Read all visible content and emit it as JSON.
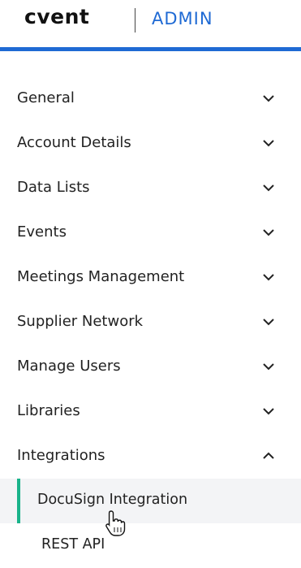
{
  "header": {
    "logo_text": "cvent",
    "section_title": "ADMIN"
  },
  "colors": {
    "brand_blue": "#1f6ad4",
    "active_accent": "#19b38a",
    "active_bg": "#f3f4f6"
  },
  "nav": {
    "items": [
      {
        "label": "General",
        "icon": "chevron-down-icon"
      },
      {
        "label": "Account Details",
        "icon": "chevron-down-icon"
      },
      {
        "label": "Data Lists",
        "icon": "chevron-down-icon"
      },
      {
        "label": "Events",
        "icon": "chevron-down-icon"
      },
      {
        "label": "Meetings Management",
        "icon": "chevron-down-icon"
      },
      {
        "label": "Supplier Network",
        "icon": "chevron-down-icon"
      },
      {
        "label": "Manage Users",
        "icon": "chevron-down-icon"
      },
      {
        "label": "Libraries",
        "icon": "chevron-down-icon"
      },
      {
        "label": "Integrations",
        "icon": "chevron-up-icon",
        "expanded": true
      }
    ],
    "integrations_children": [
      {
        "label": "DocuSign Integration",
        "active": true
      },
      {
        "label": "REST API",
        "active": false
      }
    ]
  }
}
